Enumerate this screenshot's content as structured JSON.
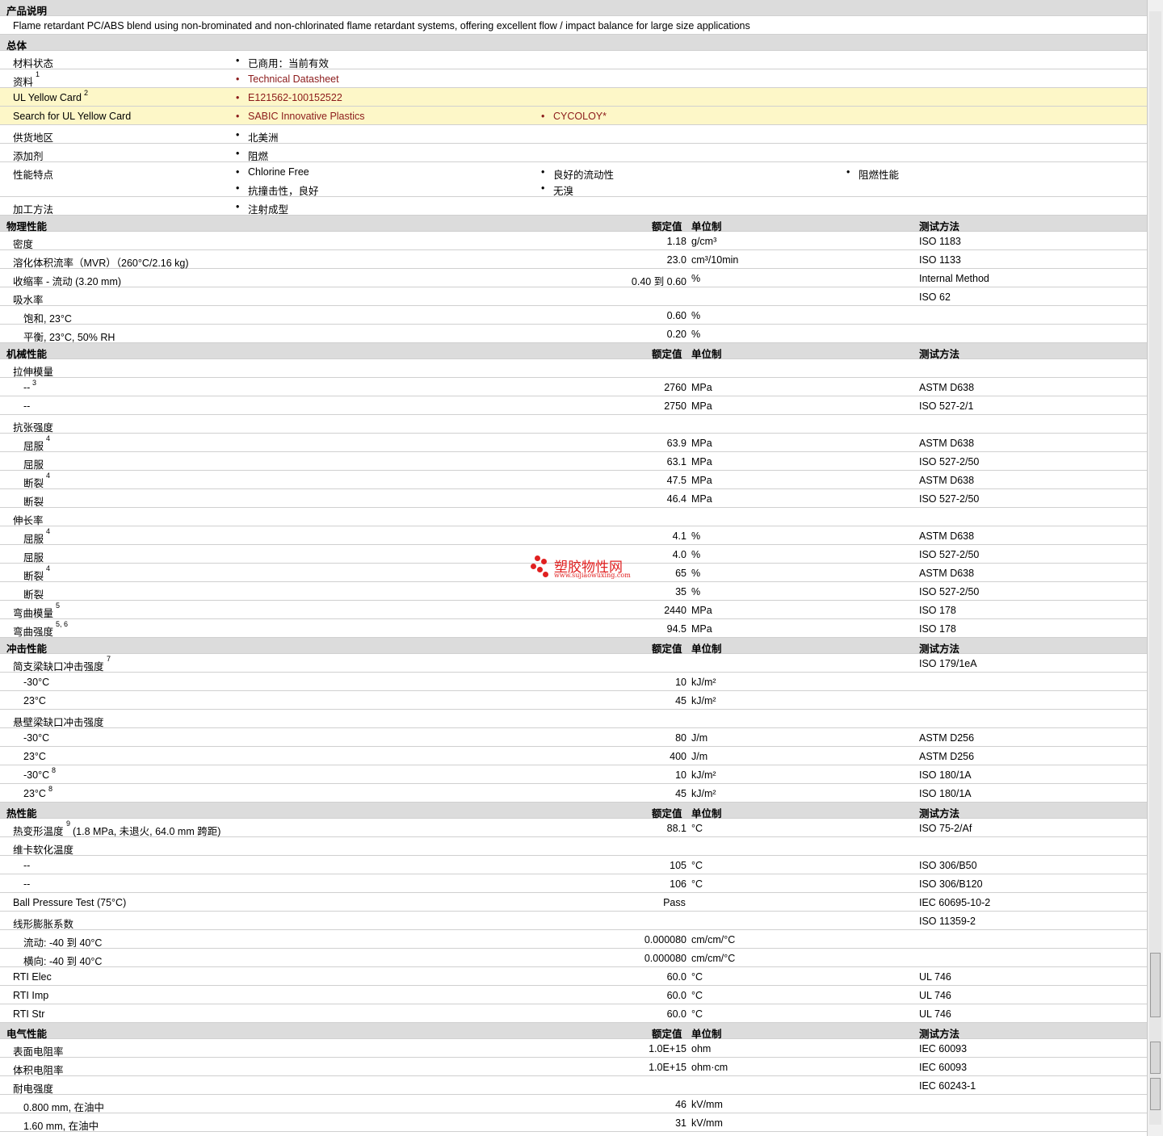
{
  "sections": [
    {
      "type": "section",
      "title": "产品说明"
    },
    {
      "type": "desc",
      "text": "Flame retardant PC/ABS blend using non-brominated and non-chlorinated flame retardant systems, offering excellent flow / impact balance for large size applications"
    },
    {
      "type": "section",
      "title": "总体"
    },
    {
      "type": "general",
      "label": "材料状态",
      "values": [
        {
          "text": "已商用：当前有效"
        }
      ]
    },
    {
      "type": "general",
      "label": "资料",
      "sup": "1",
      "values": [
        {
          "text": "Technical Datasheet",
          "link": true
        }
      ]
    },
    {
      "type": "general",
      "label": "UL Yellow Card",
      "sup": "2",
      "yellow": true,
      "values": [
        {
          "text": "E121562-100152522",
          "link": true
        }
      ]
    },
    {
      "type": "general",
      "label": "Search for UL Yellow Card",
      "yellow": true,
      "values": [
        {
          "text": "SABIC Innovative Plastics",
          "link": true
        },
        {
          "text": "CYCOLOY*",
          "link": true
        }
      ]
    },
    {
      "type": "general",
      "label": "供货地区",
      "values": [
        {
          "text": "北美洲"
        }
      ]
    },
    {
      "type": "general",
      "label": "添加剂",
      "values": [
        {
          "text": "阻燃"
        }
      ]
    },
    {
      "type": "general",
      "label": "性能特点",
      "multi": true,
      "values": [
        {
          "text": "Chlorine Free"
        },
        {
          "text": "良好的流动性"
        },
        {
          "text": "阻燃性能"
        },
        {
          "text": "抗撞击性，良好"
        },
        {
          "text": "无溴"
        }
      ]
    },
    {
      "type": "general",
      "label": "加工方法",
      "values": [
        {
          "text": "注射成型"
        }
      ]
    },
    {
      "type": "header",
      "title": "物理性能",
      "c1": "额定值",
      "c2": "单位制",
      "c3": "测试方法"
    },
    {
      "type": "data",
      "label": "密度",
      "value": "1.18",
      "unit": "g/cm³",
      "method": "ISO 1183"
    },
    {
      "type": "data",
      "label": "溶化体积流率（MVR）（260°C/2.16 kg)",
      "value": "23.0",
      "unit": "cm³/10min",
      "method": "ISO 1133"
    },
    {
      "type": "data",
      "label": "收缩率 - 流动 (3.20 mm)",
      "value": "0.40 到  0.60",
      "unit": "%",
      "method": "Internal Method"
    },
    {
      "type": "data",
      "label": "吸水率",
      "value": "",
      "unit": "",
      "method": "ISO 62"
    },
    {
      "type": "data",
      "label": "饱和, 23°C",
      "indent": true,
      "value": "0.60",
      "unit": "%",
      "method": ""
    },
    {
      "type": "data",
      "label": "平衡, 23°C, 50% RH",
      "indent": true,
      "value": "0.20",
      "unit": "%",
      "method": ""
    },
    {
      "type": "header",
      "title": "机械性能",
      "c1": "额定值",
      "c2": "单位制",
      "c3": "测试方法"
    },
    {
      "type": "data",
      "label": "拉伸模量",
      "value": "",
      "unit": "",
      "method": ""
    },
    {
      "type": "data",
      "label": "--",
      "sup": "3",
      "indent": true,
      "value": "2760",
      "unit": "MPa",
      "method": "ASTM D638"
    },
    {
      "type": "data",
      "label": "--",
      "indent": true,
      "value": "2750",
      "unit": "MPa",
      "method": "ISO 527-2/1"
    },
    {
      "type": "data",
      "label": "抗张强度",
      "value": "",
      "unit": "",
      "method": ""
    },
    {
      "type": "data",
      "label": "屈服",
      "sup": "4",
      "indent": true,
      "value": "63.9",
      "unit": "MPa",
      "method": "ASTM D638"
    },
    {
      "type": "data",
      "label": "屈服",
      "indent": true,
      "value": "63.1",
      "unit": "MPa",
      "method": "ISO 527-2/50"
    },
    {
      "type": "data",
      "label": "断裂",
      "sup": "4",
      "indent": true,
      "value": "47.5",
      "unit": "MPa",
      "method": "ASTM D638"
    },
    {
      "type": "data",
      "label": "断裂",
      "indent": true,
      "value": "46.4",
      "unit": "MPa",
      "method": "ISO 527-2/50"
    },
    {
      "type": "data",
      "label": "伸长率",
      "value": "",
      "unit": "",
      "method": ""
    },
    {
      "type": "data",
      "label": "屈服",
      "sup": "4",
      "indent": true,
      "value": "4.1",
      "unit": "%",
      "method": "ASTM D638"
    },
    {
      "type": "data",
      "label": "屈服",
      "indent": true,
      "value": "4.0",
      "unit": "%",
      "method": "ISO 527-2/50"
    },
    {
      "type": "data",
      "label": "断裂",
      "sup": "4",
      "indent": true,
      "value": "65",
      "unit": "%",
      "method": "ASTM D638"
    },
    {
      "type": "data",
      "label": "断裂",
      "indent": true,
      "value": "35",
      "unit": "%",
      "method": "ISO 527-2/50"
    },
    {
      "type": "data",
      "label": "弯曲模量",
      "sup": "5",
      "value": "2440",
      "unit": "MPa",
      "method": "ISO 178"
    },
    {
      "type": "data",
      "label": "弯曲强度",
      "sup": "5, 6",
      "value": "94.5",
      "unit": "MPa",
      "method": "ISO 178"
    },
    {
      "type": "header",
      "title": "冲击性能",
      "c1": "额定值",
      "c2": "单位制",
      "c3": "测试方法"
    },
    {
      "type": "data",
      "label": "简支梁缺口冲击强度",
      "sup": "7",
      "value": "",
      "unit": "",
      "method": "ISO 179/1eA"
    },
    {
      "type": "data",
      "label": "-30°C",
      "indent": true,
      "value": "10",
      "unit": "kJ/m²",
      "method": ""
    },
    {
      "type": "data",
      "label": "23°C",
      "indent": true,
      "value": "45",
      "unit": "kJ/m²",
      "method": ""
    },
    {
      "type": "data",
      "label": "悬壁梁缺口冲击强度",
      "value": "",
      "unit": "",
      "method": ""
    },
    {
      "type": "data",
      "label": "-30°C",
      "indent": true,
      "value": "80",
      "unit": "J/m",
      "method": "ASTM D256"
    },
    {
      "type": "data",
      "label": "23°C",
      "indent": true,
      "value": "400",
      "unit": "J/m",
      "method": "ASTM D256"
    },
    {
      "type": "data",
      "label": "-30°C",
      "sup": "8",
      "indent": true,
      "value": "10",
      "unit": "kJ/m²",
      "method": "ISO 180/1A"
    },
    {
      "type": "data",
      "label": "23°C",
      "sup": "8",
      "indent": true,
      "value": "45",
      "unit": "kJ/m²",
      "method": "ISO 180/1A"
    },
    {
      "type": "header",
      "title": "热性能",
      "c1": "额定值",
      "c2": "单位制",
      "c3": "测试方法"
    },
    {
      "type": "data",
      "label": "热变形温度",
      "sup": "9",
      "suffix": "(1.8 MPa, 未退火, 64.0 mm 跨距)",
      "value": "88.1",
      "unit": "°C",
      "method": "ISO 75-2/Af"
    },
    {
      "type": "data",
      "label": "维卡软化温度",
      "value": "",
      "unit": "",
      "method": ""
    },
    {
      "type": "data",
      "label": "--",
      "indent": true,
      "value": "105",
      "unit": "°C",
      "method": "ISO 306/B50"
    },
    {
      "type": "data",
      "label": "--",
      "indent": true,
      "value": "106",
      "unit": "°C",
      "method": "ISO 306/B120"
    },
    {
      "type": "data",
      "label": "Ball Pressure Test (75°C)",
      "value": "Pass",
      "center": true,
      "unit": "",
      "method": "IEC 60695-10-2"
    },
    {
      "type": "data",
      "label": "线形膨胀系数",
      "value": "",
      "unit": "",
      "method": "ISO 11359-2"
    },
    {
      "type": "data",
      "label": "流动: -40 到  40°C",
      "indent": true,
      "value": "0.000080",
      "unit": "cm/cm/°C",
      "method": ""
    },
    {
      "type": "data",
      "label": "横向: -40 到  40°C",
      "indent": true,
      "value": "0.000080",
      "unit": "cm/cm/°C",
      "method": ""
    },
    {
      "type": "data",
      "label": "RTI Elec",
      "value": "60.0",
      "unit": "°C",
      "method": "UL 746"
    },
    {
      "type": "data",
      "label": "RTI Imp",
      "value": "60.0",
      "unit": "°C",
      "method": "UL 746"
    },
    {
      "type": "data",
      "label": "RTI Str",
      "value": "60.0",
      "unit": "°C",
      "method": "UL 746"
    },
    {
      "type": "header",
      "title": "电气性能",
      "c1": "额定值",
      "c2": "单位制",
      "c3": "测试方法"
    },
    {
      "type": "data",
      "label": "表面电阻率",
      "value": "1.0E+15",
      "unit": "ohm",
      "method": "IEC 60093"
    },
    {
      "type": "data",
      "label": "体积电阻率",
      "value": "1.0E+15",
      "unit": "ohm·cm",
      "method": "IEC 60093"
    },
    {
      "type": "data",
      "label": "耐电强度",
      "value": "",
      "unit": "",
      "method": "IEC 60243-1"
    },
    {
      "type": "data",
      "label": "0.800 mm, 在油中",
      "indent": true,
      "value": "46",
      "unit": "kV/mm",
      "method": ""
    },
    {
      "type": "data",
      "label": "1.60 mm, 在油中",
      "indent": true,
      "value": "31",
      "unit": "kV/mm",
      "method": ""
    }
  ],
  "watermark": {
    "title": "塑胶物性网",
    "url": "www.sujiaowuxing.com"
  }
}
